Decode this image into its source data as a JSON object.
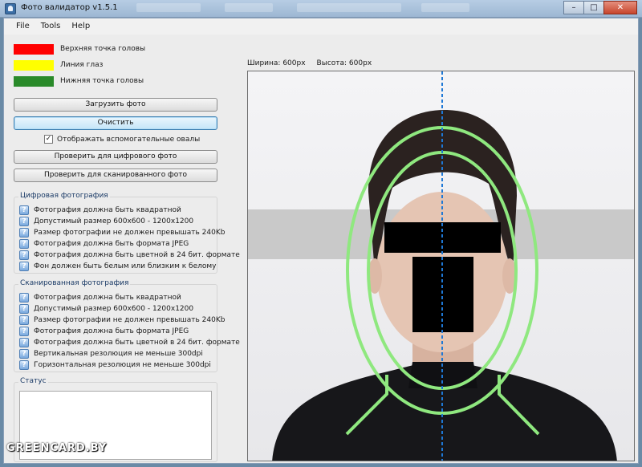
{
  "window": {
    "title": "Фото валидатор v1.5.1",
    "minimize": "–",
    "maximize": "□",
    "close": "✕"
  },
  "menu": [
    "File",
    "Tools",
    "Help"
  ],
  "legend": [
    {
      "color": "#ff0000",
      "label": "Верхняя точка головы"
    },
    {
      "color": "#ffff00",
      "label": "Линия глаз"
    },
    {
      "color": "#2a8a2a",
      "label": "Нижняя точка головы"
    }
  ],
  "buttons": {
    "load": "Загрузить фото",
    "clear": "Очистить",
    "check_digital": "Проверить для цифрового фото",
    "check_scanned": "Проверить для сканированного фото"
  },
  "show_ovals": {
    "label": "Отображать вспомогательные овалы",
    "checked": true,
    "mark": "✓"
  },
  "digital_group": {
    "title": "Цифровая фотография",
    "items": [
      "Фотография должна быть квадратной",
      "Допустимый размер 600x600 - 1200x1200",
      "Размер фотографии не должен превышать 240Kb",
      "Фотография должна быть формата JPEG",
      "Фотография должна быть цветной в 24 бит. формате",
      "Фон должен быть белым или близким к белому"
    ]
  },
  "scanned_group": {
    "title": "Сканированная фотография",
    "items": [
      "Фотография должна быть квадратной",
      "Допустимый размер 600x600 - 1200x1200",
      "Размер фотографии не должен превышать 240Kb",
      "Фотография должна быть формата JPEG",
      "Фотография должна быть цветной в 24 бит. формате",
      "Вертикальная резолюция не меньше 300dpi",
      "Горизонтальная резолюция не меньше 300dpi"
    ]
  },
  "status": {
    "title": "Статус",
    "text": ""
  },
  "image_info": {
    "width": "Ширина: 600px",
    "height": "Высота: 600px"
  },
  "item_icon": "question-icon",
  "watermark": "GREENCARD.BY",
  "colors": {
    "oval": "#8fe87f",
    "eye_band": "#c9c9c9",
    "axis": "#1e78d6"
  }
}
